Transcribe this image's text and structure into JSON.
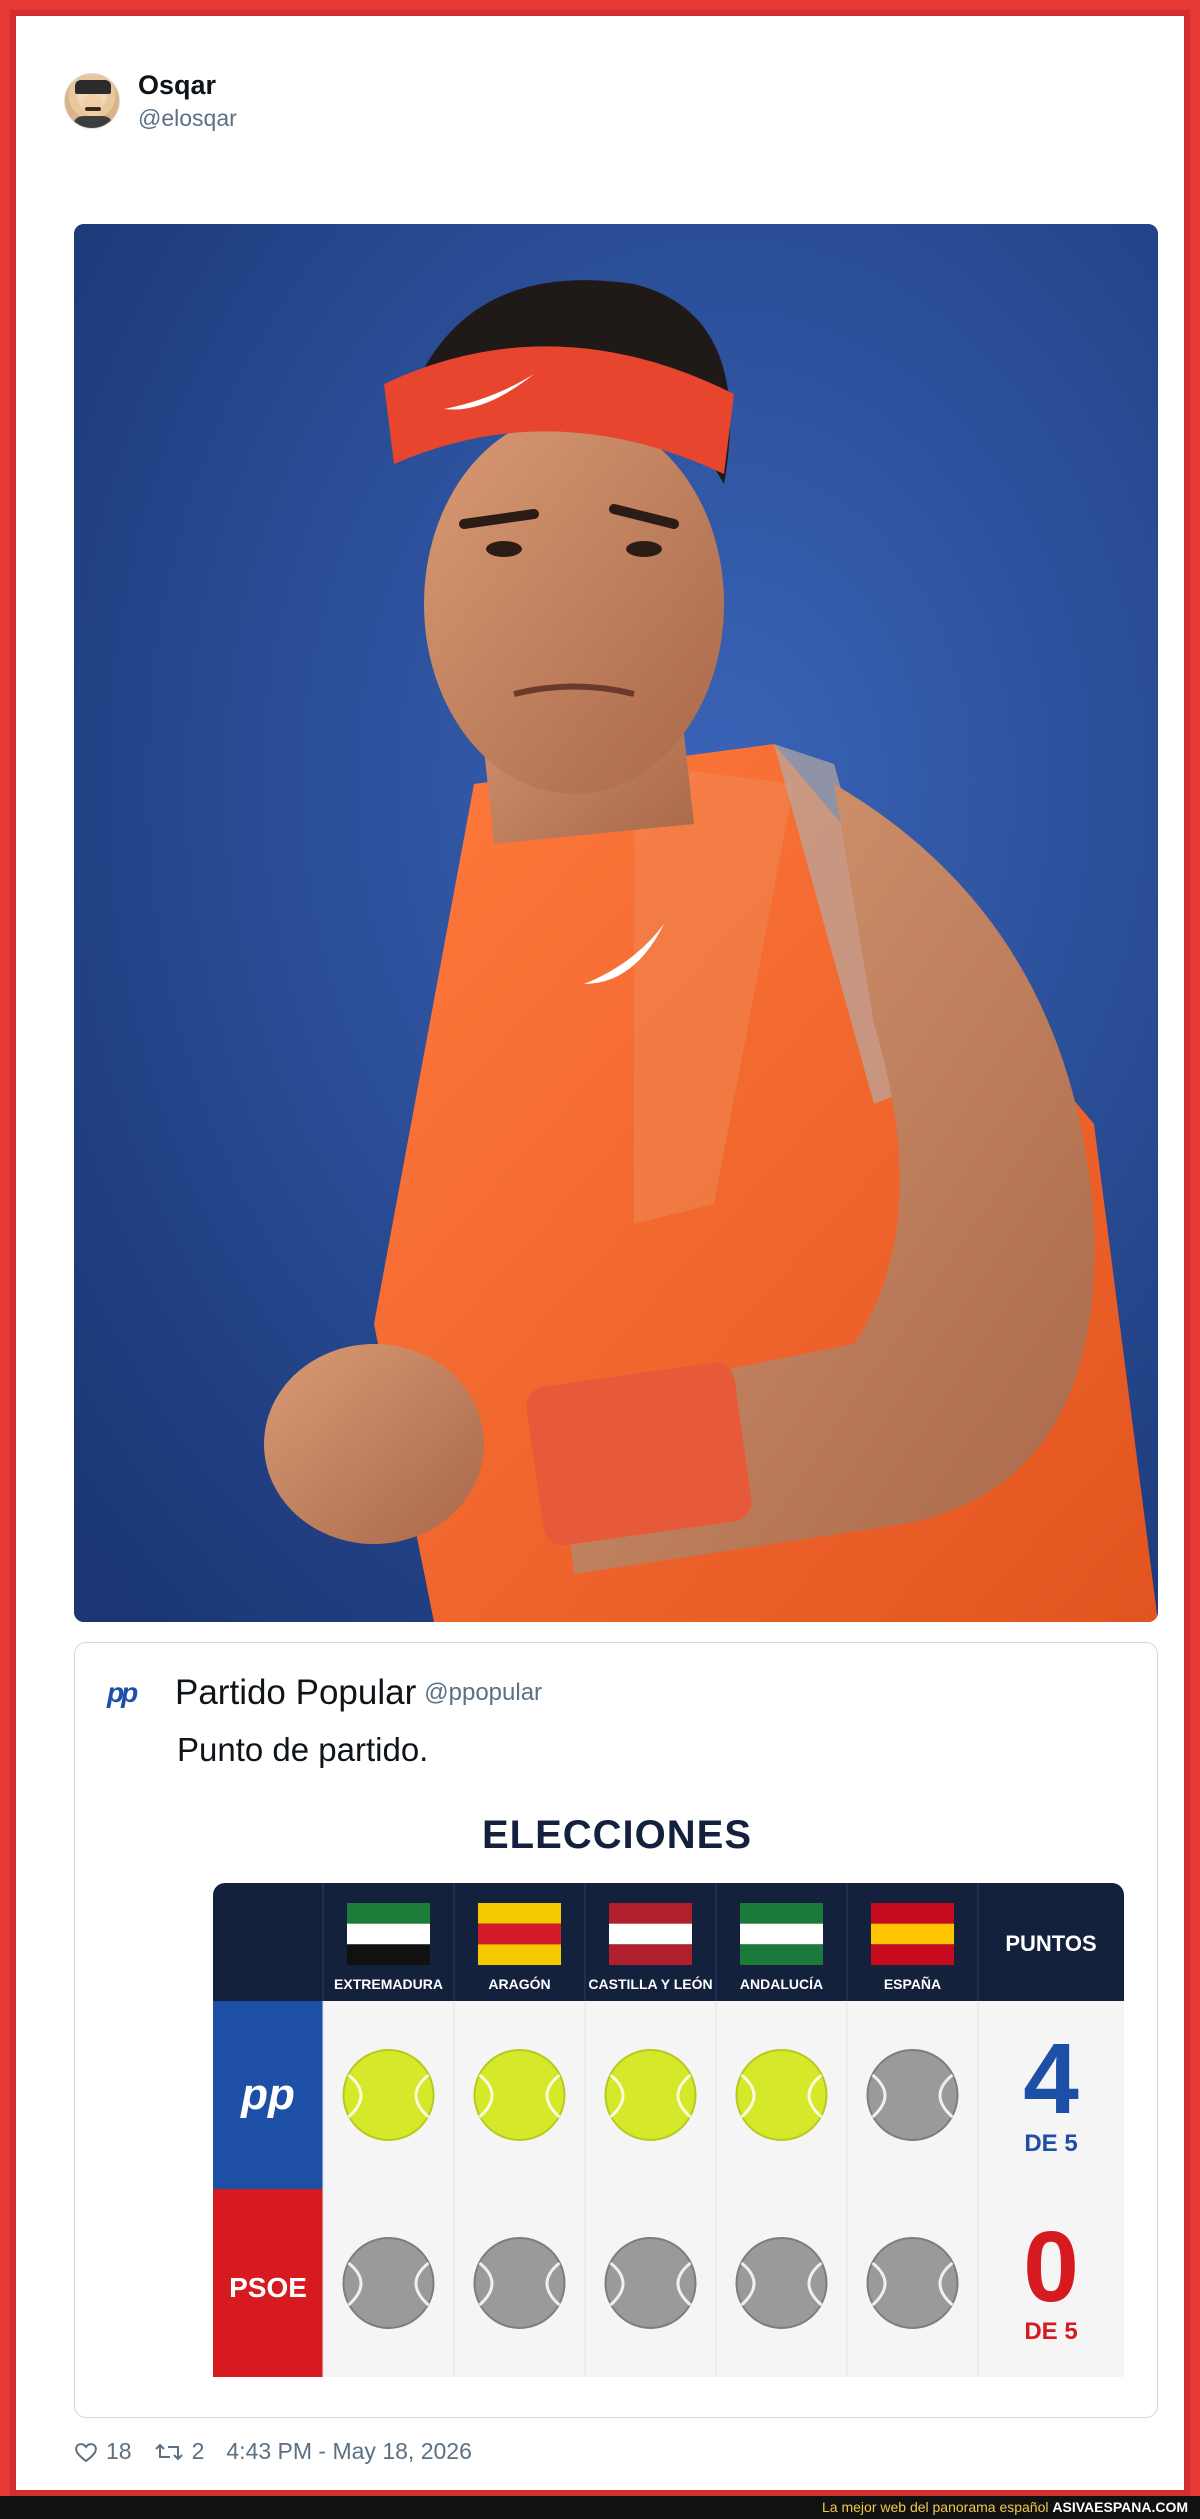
{
  "tweet": {
    "display_name": "Osqar",
    "handle": "@elosqar",
    "likes": "18",
    "retweets": "2",
    "timestamp": "4:43 PM - May 18, 2026"
  },
  "quoted_tweet": {
    "display_name": "Partido Popular",
    "handle": "@ppopular",
    "text": "Punto de partido.",
    "logo_text": "pp"
  },
  "graphic": {
    "title": "ELECCIONES",
    "columns": [
      "EXTREMADURA",
      "ARAGÓN",
      "CASTILLA Y LEÓN",
      "ANDALUCÍA",
      "ESPAÑA"
    ],
    "points_header": "PUNTOS",
    "rows": [
      {
        "party": "pp",
        "score": "4",
        "of": "DE 5",
        "color": "#1e4fa7",
        "balls": [
          1,
          1,
          1,
          1,
          0
        ]
      },
      {
        "party": "PSOE",
        "score": "0",
        "of": "DE 5",
        "color": "#d71920",
        "balls": [
          0,
          0,
          0,
          0,
          0
        ]
      }
    ]
  },
  "footer": {
    "text": "La mejor web del panorama español",
    "site": "ASIVAESPANA.COM"
  },
  "colors": {
    "header_navy": "#14213d",
    "pp_blue": "#1e4fa7",
    "psoe_red": "#d71920",
    "ball_yellow": "#d6e82a",
    "ball_grey": "#9a9a9a"
  }
}
